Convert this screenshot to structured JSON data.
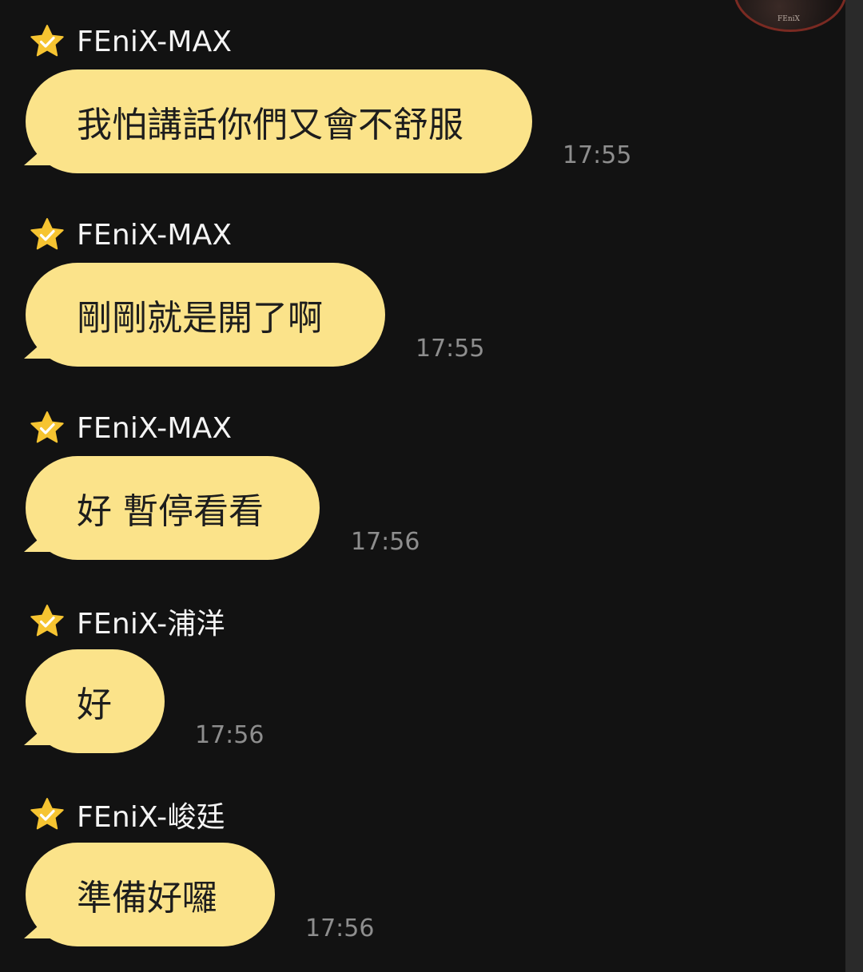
{
  "chat": {
    "messages": [
      {
        "sender": "FEniX-MAX",
        "text": "我怕講話你們又會不舒服",
        "time": "17:55"
      },
      {
        "sender": "FEniX-MAX",
        "text": "剛剛就是開了啊",
        "time": "17:55"
      },
      {
        "sender": "FEniX-MAX",
        "text": "好 暫停看看",
        "time": "17:56"
      },
      {
        "sender": "FEniX-浦洋",
        "text": "好",
        "time": "17:56"
      },
      {
        "sender": "FEniX-峻廷",
        "text": "準備好囉",
        "time": "17:56"
      }
    ]
  },
  "avatar": {
    "label": "FEniX"
  },
  "icons": {
    "sender_badge": "star-check-icon"
  },
  "colors": {
    "background": "#121212",
    "bubble": "#fbe38a",
    "star": "#f6c431",
    "sender_text": "#f4f4f4",
    "timestamp": "#8e8e8e"
  }
}
